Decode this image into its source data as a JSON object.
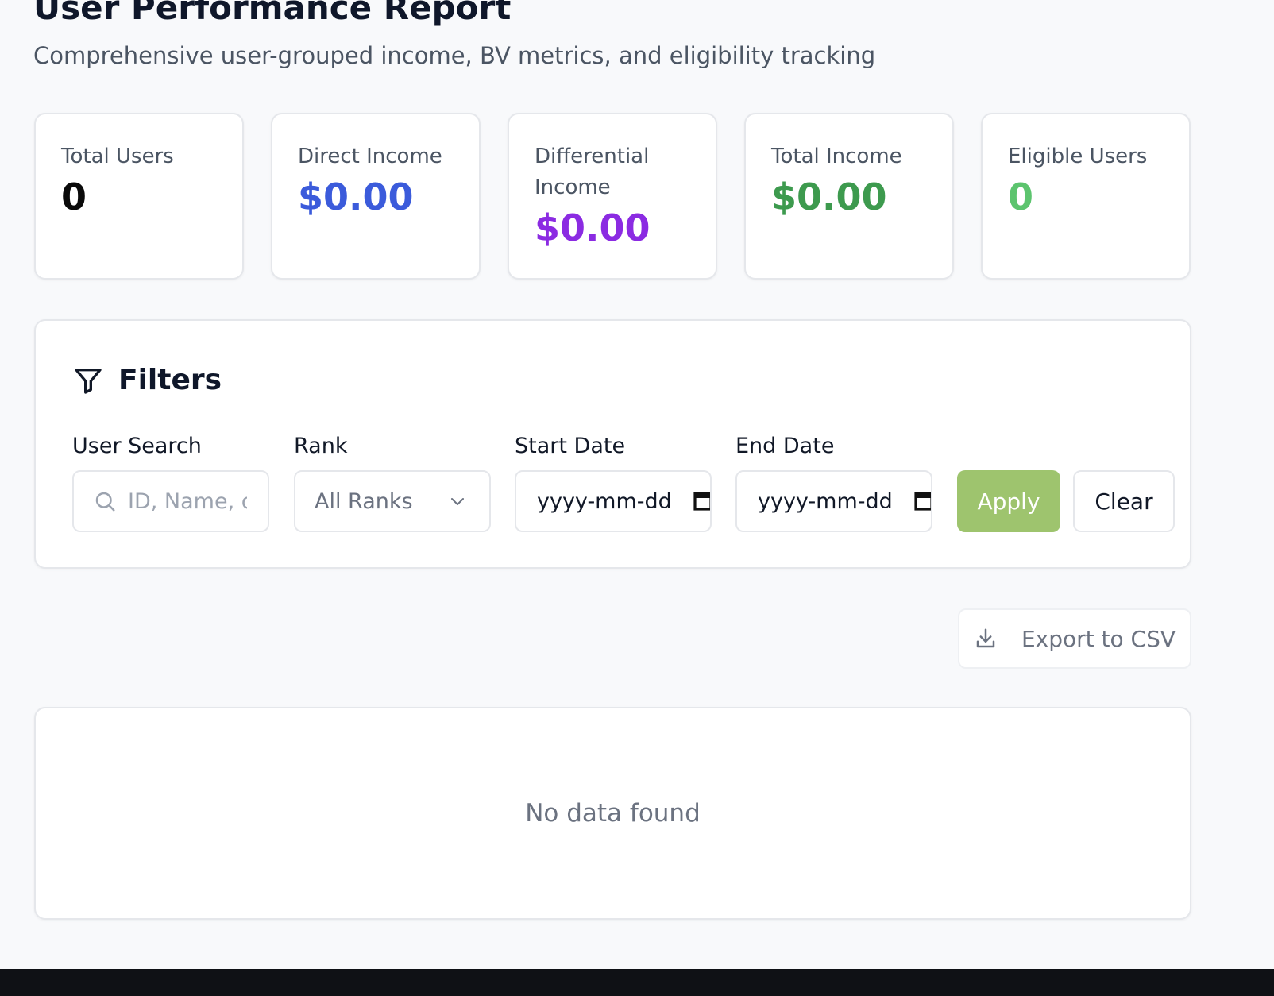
{
  "header": {
    "title": "User Performance Report",
    "subtitle": "Comprehensive user-grouped income, BV metrics, and eligibility tracking"
  },
  "stats": [
    {
      "label": "Total Users",
      "value": "0",
      "color": "#0a0a0a"
    },
    {
      "label": "Direct Income",
      "value": "$0.00",
      "color": "#3b5bdb"
    },
    {
      "label": "Differential Income",
      "value": "$0.00",
      "color": "#8b2be2"
    },
    {
      "label": "Total Income",
      "value": "$0.00",
      "color": "#3d9a4e"
    },
    {
      "label": "Eligible Users",
      "value": "0",
      "color": "#5cc46e"
    }
  ],
  "filters": {
    "title": "Filters",
    "icon": "filter-icon",
    "user_search": {
      "label": "User Search",
      "placeholder": "ID, Name, c",
      "icon": "search-icon"
    },
    "rank": {
      "label": "Rank",
      "selected": "All Ranks",
      "icon": "chevron-down-icon"
    },
    "start_date": {
      "label": "Start Date",
      "value": "yyyy-mm-dd",
      "icon": "calendar-icon"
    },
    "end_date": {
      "label": "End Date",
      "value": "yyyy-mm-dd",
      "icon": "calendar-icon"
    },
    "apply_label": "Apply",
    "clear_label": "Clear"
  },
  "export": {
    "label": "Export to CSV",
    "icon": "download-icon"
  },
  "results": {
    "empty_message": "No data found"
  },
  "colors": {
    "accent_green": "#9ec46e",
    "background": "#f8f9fb"
  }
}
